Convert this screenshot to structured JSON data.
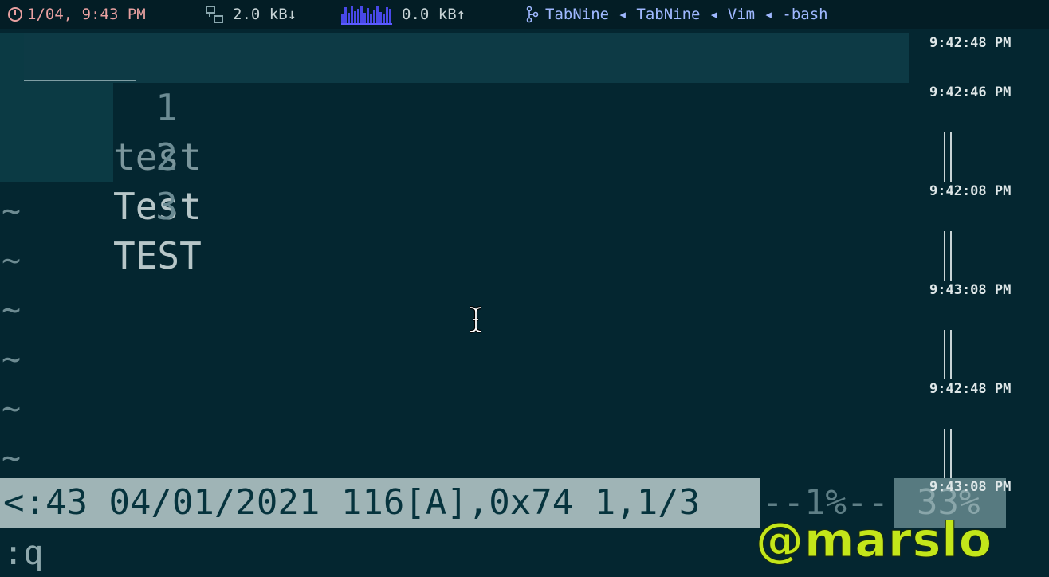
{
  "topbar": {
    "datetime": "1/04, 9:43 PM",
    "download": "2.0 kB↓",
    "upload": "0.0 kB↑",
    "path": "TabNine ◂ TabNine ◂ Vim ◂ -bash",
    "sparkline_levels": [
      0.5,
      0.9,
      0.6,
      1.0,
      0.7,
      0.8,
      0.95,
      0.6,
      0.85,
      0.5,
      0.75,
      1.0,
      0.65,
      0.55,
      0.9,
      0.8
    ]
  },
  "editor": {
    "lines": [
      {
        "num": "1",
        "text": "test"
      },
      {
        "num": "2",
        "text": "Test"
      },
      {
        "num": "3",
        "text": "TEST"
      }
    ],
    "tilde": "~"
  },
  "timestamps": [
    "9:42:48 PM",
    "9:42:46 PM",
    "9:42:08 PM",
    "9:43:08 PM",
    "9:42:48 PM",
    "9:43:08 PM"
  ],
  "statusline": {
    "main": "<:43 04/01/2021 116[A],0x74 1,1/3 ",
    "percent": "--1%--",
    "right": "33%"
  },
  "cmdline": ":q",
  "watermark": "@marslo",
  "colors": {
    "background": "#042630",
    "statusline": "#9fb4b6",
    "watermark": "#c3e61a",
    "datetime": "#e8a0a0",
    "path": "#9fb8ff"
  }
}
